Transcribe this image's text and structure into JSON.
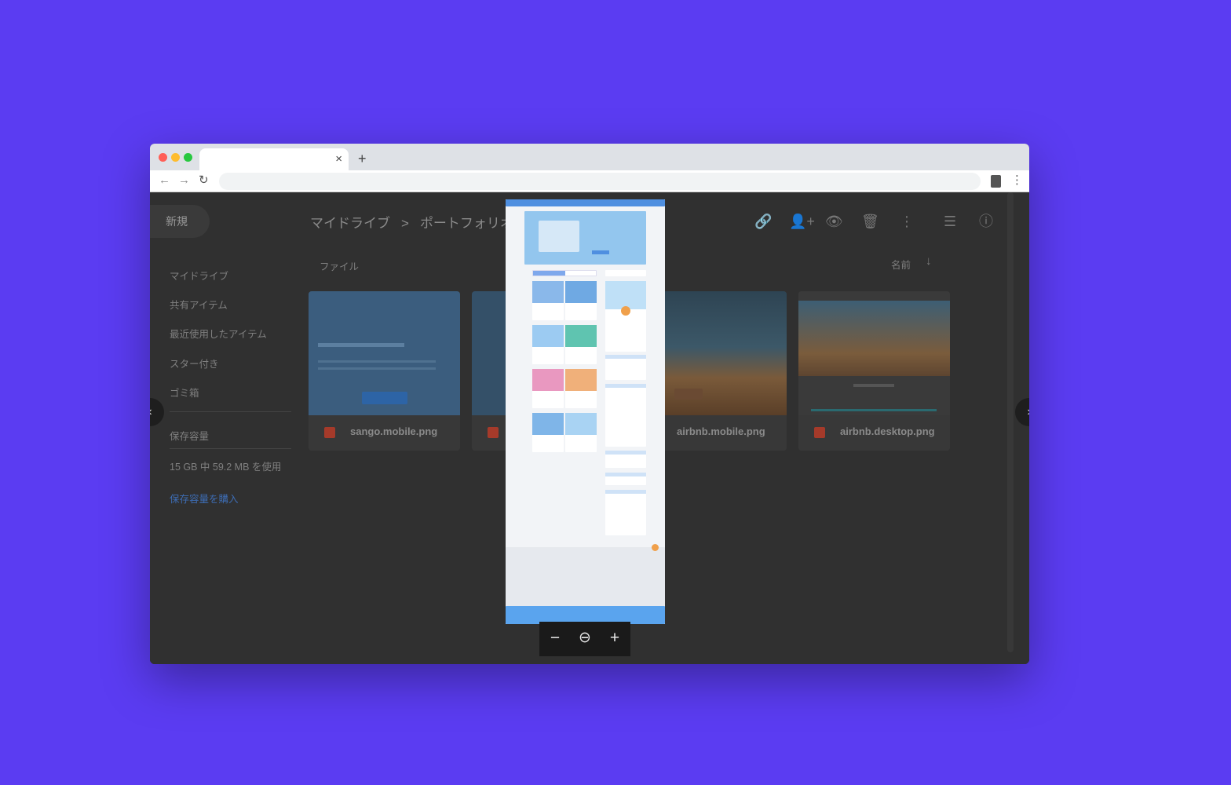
{
  "browser": {
    "traffic_lights": [
      "#ff5f57",
      "#febc2e",
      "#28c840"
    ],
    "tab_close": "×",
    "new_tab": "+",
    "back": "←",
    "forward": "→",
    "reload": "↻",
    "menu": "⋮"
  },
  "drive": {
    "new_button": "新規",
    "sidebar": {
      "items": [
        "マイドライブ",
        "共有アイテム",
        "最近使用したアイテム",
        "スター付き",
        "ゴミ箱"
      ],
      "storage_label": "保存容量",
      "storage_usage": "15 GB 中 59.2 MB を使用",
      "buy_storage": "保存容量を購入"
    },
    "breadcrumb": {
      "root": "マイドライブ",
      "separator": ">",
      "current": "ポートフォリオ"
    },
    "actions": {
      "link": "🔗",
      "share": "👤+",
      "preview": "👁",
      "delete": "🗑",
      "more": "⋮",
      "list_view": "☰",
      "info": "ⓘ"
    },
    "files_heading": "ファイル",
    "sort_label": "名前",
    "sort_arrow": "↓",
    "files": [
      {
        "name": "sango.mobile.png"
      },
      {
        "name": ""
      },
      {
        "name": "airbnb.mobile.png"
      },
      {
        "name": "airbnb.desktop.png"
      }
    ]
  },
  "viewer": {
    "prev_arrow": "‹",
    "next_arrow": "›",
    "zoom_out": "−",
    "zoom_icon": "⊖",
    "zoom_in": "+"
  }
}
